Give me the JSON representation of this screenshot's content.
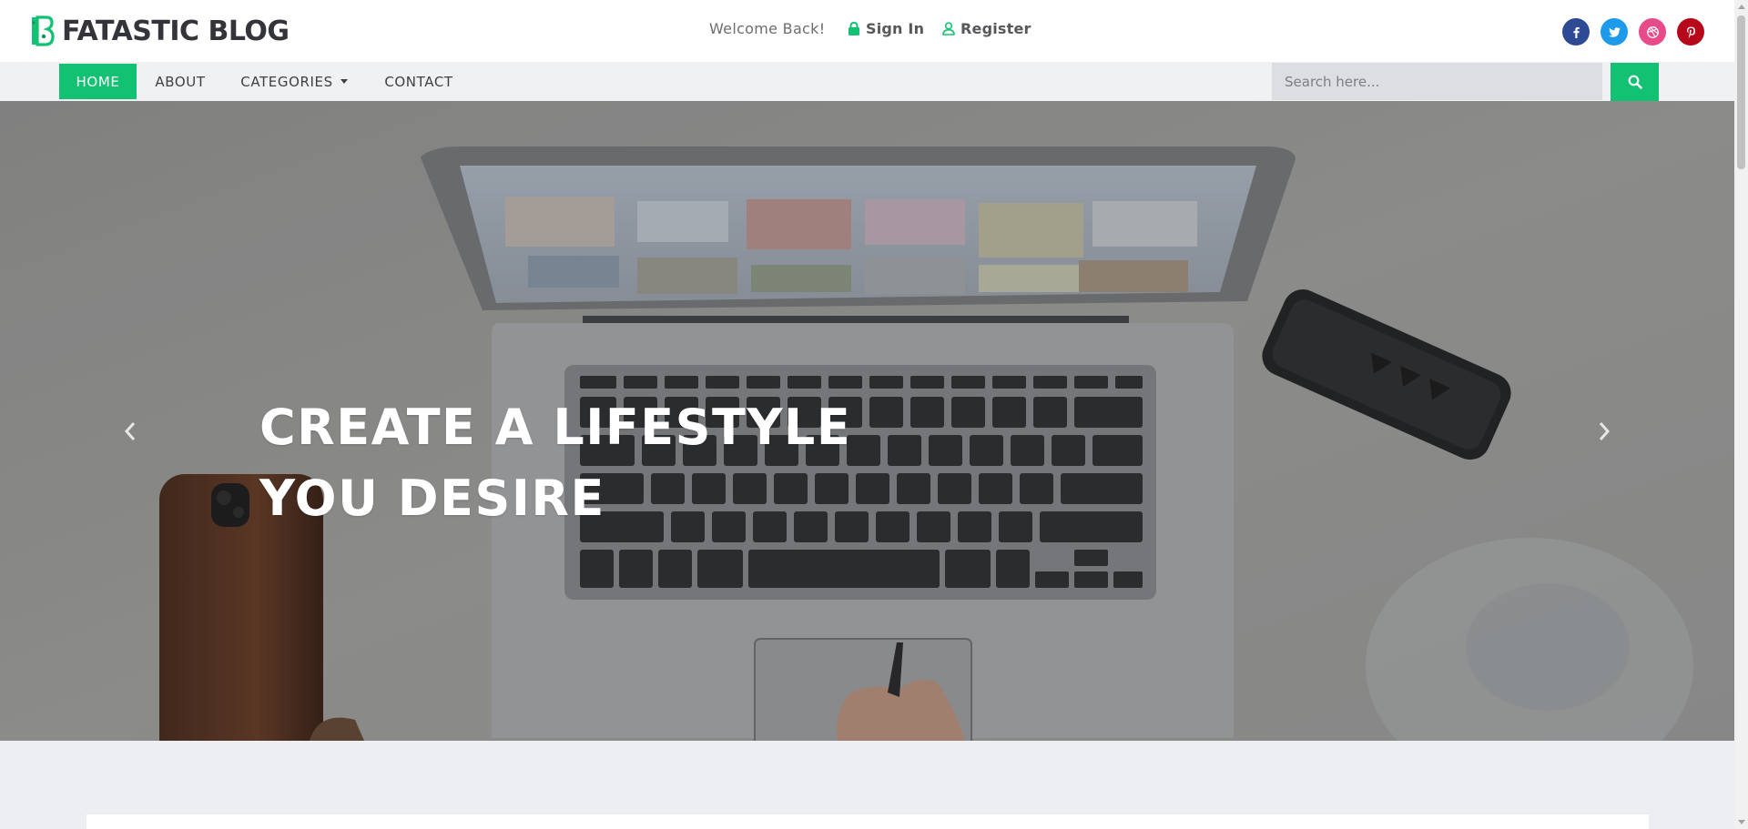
{
  "header": {
    "logo_text": "FATASTIC BLOG",
    "welcome_text": "Welcome Back!",
    "signin_label": "Sign In",
    "register_label": "Register",
    "socials": [
      {
        "name": "facebook",
        "glyph": "f",
        "color": "#3b5998"
      },
      {
        "name": "twitter",
        "glyph": "t",
        "color": "#1da1f2"
      },
      {
        "name": "dribbble",
        "glyph": "d",
        "color": "#ea4c89"
      },
      {
        "name": "pinterest",
        "glyph": "p",
        "color": "#bd081c"
      }
    ]
  },
  "nav": {
    "items": [
      {
        "label": "HOME",
        "active": true
      },
      {
        "label": "ABOUT",
        "active": false
      },
      {
        "label": "CATEGORIES",
        "active": false,
        "dropdown": true
      },
      {
        "label": "CONTACT",
        "active": false
      }
    ],
    "search_placeholder": "Search here..."
  },
  "hero": {
    "title_line1": "CREATE A LIFESTYLE",
    "title_line2": "YOU DESIRE",
    "image_subject": "laptop keyboard top-down with phone, speaker and glass on white desk"
  },
  "colors": {
    "accent": "#12c272",
    "logo_text": "#33353a",
    "nav_bg": "#f0f1f2",
    "page_bg": "#eceef1"
  }
}
